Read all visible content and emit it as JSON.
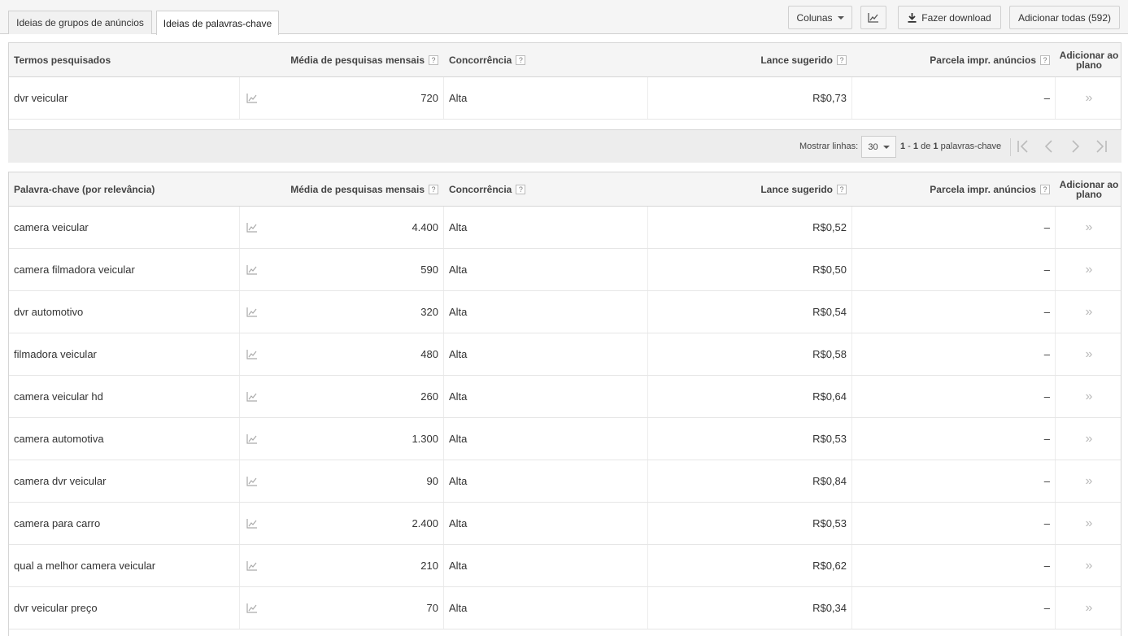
{
  "tabs": [
    {
      "label": "Ideias de grupos de anúncios",
      "active": false
    },
    {
      "label": "Ideias de palavras-chave",
      "active": true
    }
  ],
  "toolbar": {
    "columns_label": "Colunas",
    "download_label": "Fazer download",
    "add_all_label": "Adicionar todas (592)"
  },
  "columns": {
    "avg_searches": "Média de pesquisas mensais",
    "competition": "Concorrência",
    "suggested_bid": "Lance sugerido",
    "impr_share": "Parcela impr. anúncios",
    "add_to_plan_line1": "Adicionar ao",
    "add_to_plan_line2": "plano",
    "help": "?"
  },
  "searched": {
    "header": "Termos pesquisados",
    "rows": [
      {
        "term": "dvr veicular",
        "avg": "720",
        "competition": "Alta",
        "bid": "R$0,73",
        "share": "–",
        "add": "»"
      }
    ]
  },
  "pagination": {
    "show_rows_label": "Mostrar linhas:",
    "rows_value": "30",
    "range_start": "1",
    "range_sep": " - ",
    "range_end": "1",
    "range_of": " de ",
    "range_total": "1",
    "range_suffix": " palavras-chave"
  },
  "keywords": {
    "header": "Palavra-chave (por relevância)",
    "rows": [
      {
        "term": "camera veicular",
        "avg": "4.400",
        "competition": "Alta",
        "bid": "R$0,52",
        "share": "–",
        "add": "»"
      },
      {
        "term": "camera filmadora veicular",
        "avg": "590",
        "competition": "Alta",
        "bid": "R$0,50",
        "share": "–",
        "add": "»"
      },
      {
        "term": "dvr automotivo",
        "avg": "320",
        "competition": "Alta",
        "bid": "R$0,54",
        "share": "–",
        "add": "»"
      },
      {
        "term": "filmadora veicular",
        "avg": "480",
        "competition": "Alta",
        "bid": "R$0,58",
        "share": "–",
        "add": "»"
      },
      {
        "term": "camera veicular hd",
        "avg": "260",
        "competition": "Alta",
        "bid": "R$0,64",
        "share": "–",
        "add": "»"
      },
      {
        "term": "camera automotiva",
        "avg": "1.300",
        "competition": "Alta",
        "bid": "R$0,53",
        "share": "–",
        "add": "»"
      },
      {
        "term": "camera dvr veicular",
        "avg": "90",
        "competition": "Alta",
        "bid": "R$0,84",
        "share": "–",
        "add": "»"
      },
      {
        "term": "camera para carro",
        "avg": "2.400",
        "competition": "Alta",
        "bid": "R$0,53",
        "share": "–",
        "add": "»"
      },
      {
        "term": "qual a melhor camera veicular",
        "avg": "210",
        "competition": "Alta",
        "bid": "R$0,62",
        "share": "–",
        "add": "»"
      },
      {
        "term": "dvr veicular preço",
        "avg": "70",
        "competition": "Alta",
        "bid": "R$0,34",
        "share": "–",
        "add": "»"
      }
    ]
  },
  "colors": {
    "border": "#d6d6d6",
    "header_bg": "#f5f5f5",
    "icon": "#999999"
  }
}
